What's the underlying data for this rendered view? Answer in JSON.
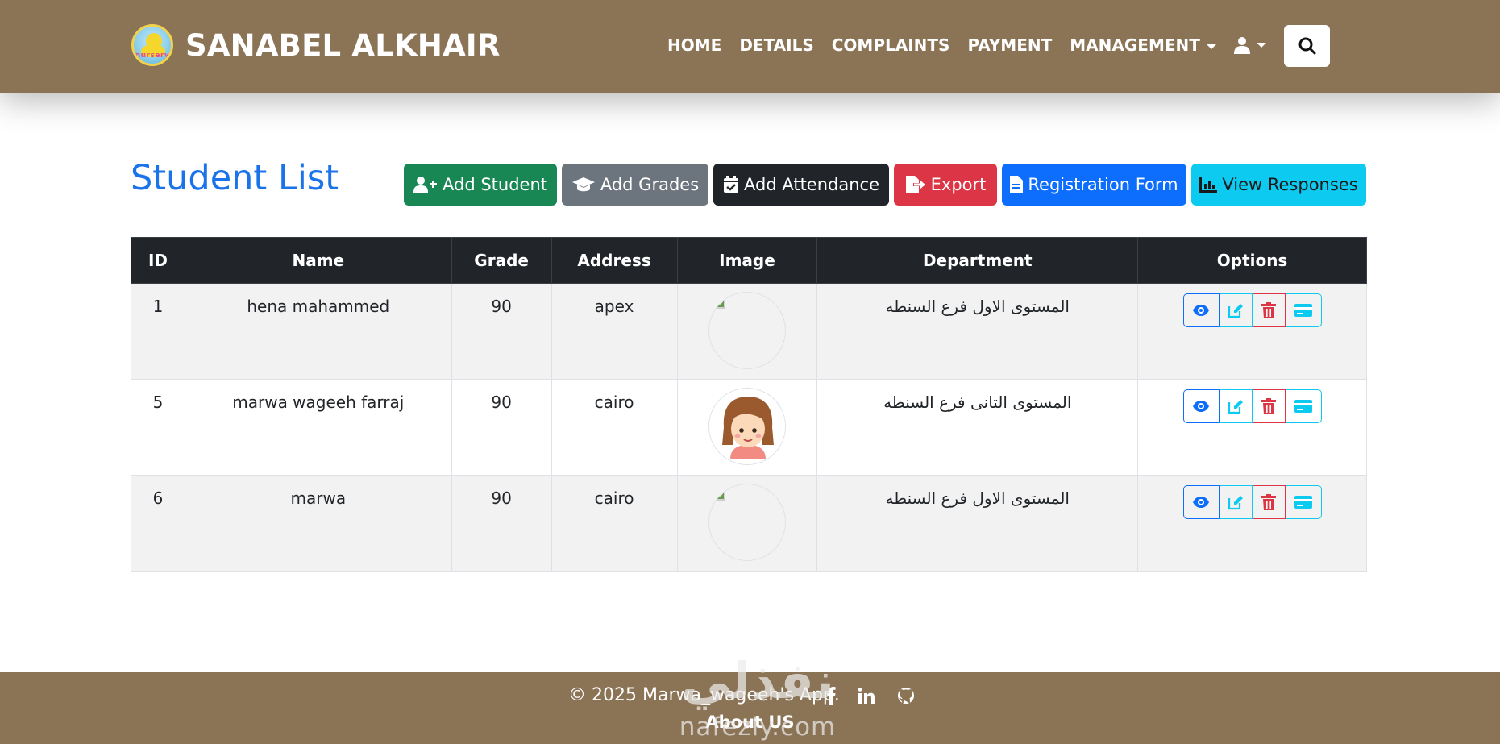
{
  "header": {
    "brand": "SANABEL ALKHAIR",
    "logo_text": "nursery",
    "nav": [
      "HOME",
      "DETAILS",
      "COMPLAINTS",
      "PAYMENT",
      "MANAGEMENT"
    ]
  },
  "main": {
    "title": "Student List",
    "actions": {
      "add_student": "Add Student",
      "add_grades": "Add Grades",
      "add_attendance": "Add Attendance",
      "export": "Export",
      "registration_form": "Registration Form",
      "view_responses": "View Responses"
    }
  },
  "table": {
    "headers": [
      "ID",
      "Name",
      "Grade",
      "Address",
      "Image",
      "Department",
      "Options"
    ],
    "rows": [
      {
        "id": "1",
        "name": "hena mahammed",
        "grade": "90",
        "address": "apex",
        "department": "المستوى الاول فرع السنطه"
      },
      {
        "id": "5",
        "name": "marwa wageeh farraj",
        "grade": "90",
        "address": "cairo",
        "department": "المستوى التانى فرع السنطه"
      },
      {
        "id": "6",
        "name": "marwa",
        "grade": "90",
        "address": "cairo",
        "department": "المستوى الاول فرع السنطه"
      }
    ]
  },
  "footer": {
    "copyright": "© 2025 Marwa_wageeh's App.",
    "about": "About US"
  },
  "watermark": {
    "arabic": "نفذلي",
    "latin": "nafezly.com"
  },
  "colors": {
    "header_bg": "#8b7355",
    "title_blue": "#1a73e8",
    "table_head": "#212529"
  }
}
